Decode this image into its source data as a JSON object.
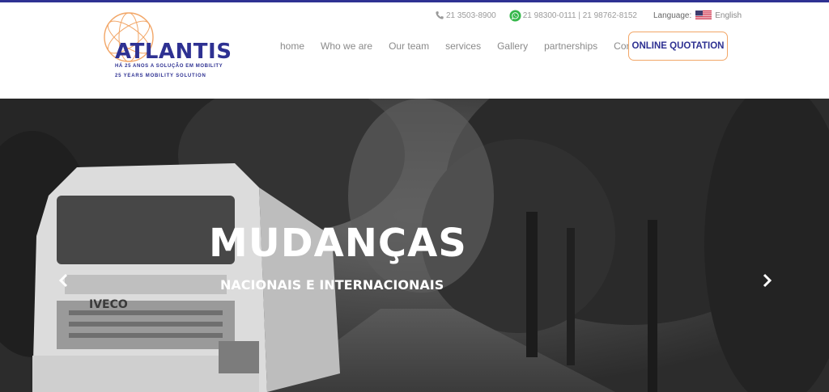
{
  "brand": {
    "name": "ATLANTIS",
    "tagline_pt": "HÁ 25 ANOS A SOLUÇÃO EM MOBILITY",
    "tagline_en": "25 YEARS MOBILITY SOLUTION",
    "color_primary": "#2e3192",
    "color_accent": "#f2a667"
  },
  "contact": {
    "phone": "21 3503-8900",
    "whatsapp": "21 98300-0111 | 21 98762-8152",
    "language_label": "Language:",
    "language_value": "English",
    "phone_icon": "phone-icon",
    "whatsapp_icon": "whatsapp-icon",
    "flag_icon": "us-flag-icon"
  },
  "nav": {
    "items": [
      "home",
      "Who we are",
      "Our team",
      "services",
      "Gallery",
      "partnerships",
      "Contact"
    ],
    "cta": "ONLINE QUOTATION"
  },
  "hero": {
    "title": "MUDANÇAS",
    "subtitle": "NACIONAIS E INTERNACIONAIS",
    "prev_icon": "chevron-left-icon",
    "next_icon": "chevron-right-icon"
  }
}
